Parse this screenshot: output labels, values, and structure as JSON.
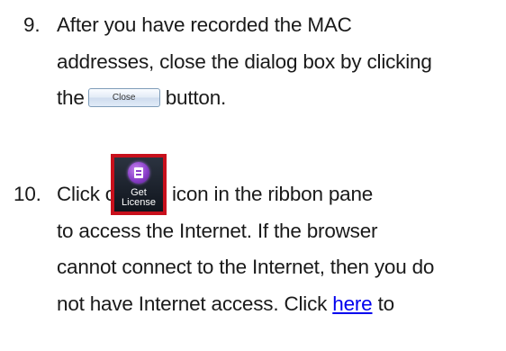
{
  "step9": {
    "number": "9.",
    "line1": "After you have recorded the MAC",
    "line2": "addresses, close the dialog box by clicking",
    "line3_before": "the",
    "button_label": "Close",
    "line3_after": "button."
  },
  "step10": {
    "number": "10.",
    "line1_before": "Click on the",
    "icon_label_line1": "Get",
    "icon_label_line2": "License",
    "line1_after": "icon in the ribbon pane",
    "line2": "to access the Internet.  If the browser",
    "line3": "cannot connect to the Internet, then you do",
    "line4": "not have Internet access.  Click",
    "link_text": "here",
    "line4_after": "to"
  },
  "colors": {
    "text": "#1a1a1a",
    "link": "#0000ee",
    "icon_border": "#c8101c",
    "icon_background": "#10151d",
    "icon_circle": "#8a3fc9"
  },
  "icons": {
    "ribbon_icon": "get-license-icon"
  }
}
